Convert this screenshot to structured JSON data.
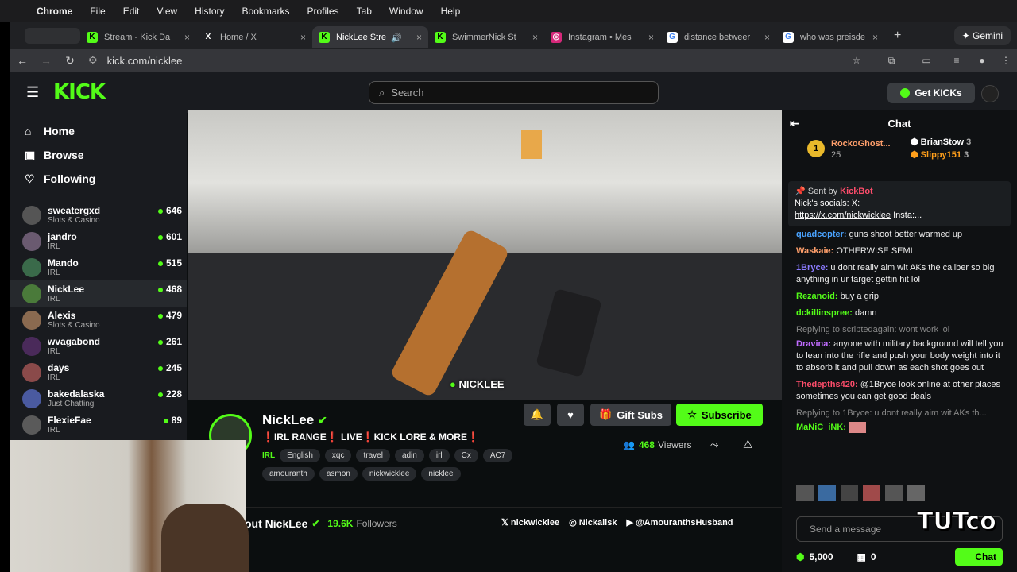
{
  "menubar": {
    "items": [
      "Chrome",
      "File",
      "Edit",
      "View",
      "History",
      "Bookmarks",
      "Profiles",
      "Tab",
      "Window",
      "Help"
    ]
  },
  "tabs": [
    {
      "label": "Stream - Kick Da",
      "fav": "K"
    },
    {
      "label": "Home / X",
      "fav": "X"
    },
    {
      "label": "NickLee Stre",
      "fav": "K",
      "active": true
    },
    {
      "label": "SwimmerNick St",
      "fav": "K"
    },
    {
      "label": "Instagram • Mes",
      "fav": "◎"
    },
    {
      "label": "distance betweer",
      "fav": "G"
    },
    {
      "label": "who was preisde",
      "fav": "G"
    }
  ],
  "gemini": "Gemini",
  "url": "kick.com/nicklee",
  "search_placeholder": "Search",
  "get_kicks": "Get KICKs",
  "nav": {
    "home": "Home",
    "browse": "Browse",
    "following": "Following"
  },
  "channels": [
    {
      "name": "sweatergxd",
      "cat": "Slots & Casino",
      "viewers": "646"
    },
    {
      "name": "jandro",
      "cat": "IRL",
      "viewers": "601"
    },
    {
      "name": "Mando",
      "cat": "IRL",
      "viewers": "515"
    },
    {
      "name": "NickLee",
      "cat": "IRL",
      "viewers": "468"
    },
    {
      "name": "Alexis",
      "cat": "Slots & Casino",
      "viewers": "479"
    },
    {
      "name": "wvagabond",
      "cat": "IRL",
      "viewers": "261"
    },
    {
      "name": "days",
      "cat": "IRL",
      "viewers": "245"
    },
    {
      "name": "bakedalaska",
      "cat": "Just Chatting",
      "viewers": "228"
    },
    {
      "name": "FlexieFae",
      "cat": "IRL",
      "viewers": "89"
    }
  ],
  "video_watermark": "NICKLEE",
  "stream": {
    "name": "NickLee",
    "subtitle": "❗IRL RANGE❗ LIVE❗KICK LORE & MORE❗",
    "category": "IRL",
    "tags": [
      "English",
      "xqc",
      "travel",
      "adin",
      "irl",
      "Cx",
      "AC7",
      "amouranth",
      "asmon",
      "nickwicklee",
      "nicklee"
    ],
    "gift_subs": "Gift Subs",
    "subscribe": "Subscribe",
    "viewers": "468",
    "viewers_label": "Viewers",
    "about": "out NickLee",
    "followers": "19.6K",
    "followers_label": "Followers",
    "socials": [
      "nickwicklee",
      "Nickalisk",
      "@AmouranthsHusband"
    ]
  },
  "chat": {
    "title": "Chat",
    "leaders": [
      {
        "name": "RockoGhost...",
        "n": "25"
      },
      {
        "name": "BrianStow",
        "n": "3"
      },
      {
        "name": "Slippy151",
        "n": "3"
      }
    ],
    "pinned_by": "Sent by",
    "pinned_user": "KickBot",
    "pinned_text": "Nick's socials: X:",
    "pinned_link": "https://x.com/nickwicklee",
    "pinned_more": "Insta:...",
    "messages": [
      {
        "user": "quadcopter:",
        "text": "guns shoot better warmed up",
        "color": "#4aa3ff"
      },
      {
        "user": "Waskaie:",
        "text": "OTHERWISE SEMI",
        "color": "#ff9f6b"
      },
      {
        "user": "1Bryce:",
        "text": "u dont really aim wit AKs the caliber so big anything in ur target gettin hit lol",
        "color": "#8b7bff"
      },
      {
        "user": "Rezanoid:",
        "text": "buy a grip",
        "color": "#53fc18"
      },
      {
        "user": "dckillinspree:",
        "text": "damn",
        "color": "#53fc18"
      },
      {
        "reply": "Replying to scriptedagain: wont work lol",
        "user": "Dravina:",
        "text": "anyone with military background will tell you to lean into the rifle and push your body weight into it to absorb it and pull down as each shot goes out",
        "color": "#c06bff"
      },
      {
        "user": "Thedepths420:",
        "text": "@1Bryce look online at other places sometimes you can get good deals",
        "color": "#ff4d6b"
      },
      {
        "reply": "Replying to 1Bryce: u dont really aim wit AKs th...",
        "user": "MaNiC_iNK:",
        "text": "",
        "color": "#53fc18"
      }
    ],
    "input_placeholder": "Send a message",
    "points": "5,000",
    "drops": "0",
    "chat_btn": "Chat"
  },
  "overlay_logo": "TUTco"
}
